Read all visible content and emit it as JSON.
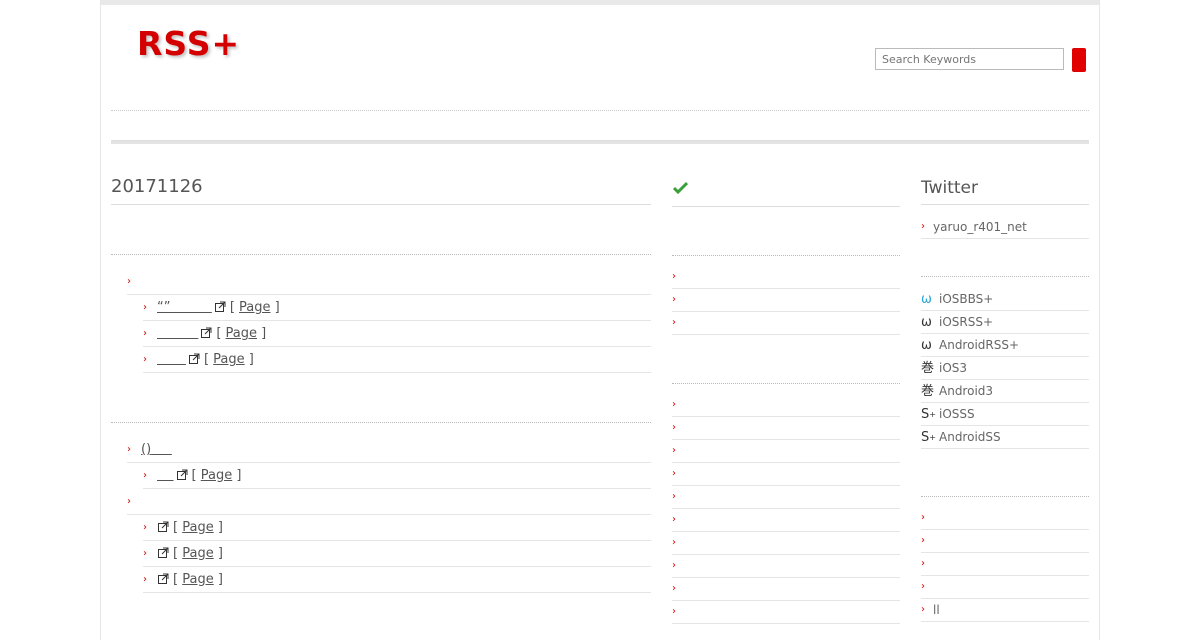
{
  "site": {
    "logo": "RSS+"
  },
  "search": {
    "placeholder": "Search Keywords",
    "value": "Search Keywords"
  },
  "main": {
    "date_heading": "20171126",
    "group1": {
      "items": [
        {
          "title": "“”",
          "page_label": "Page"
        },
        {
          "title": "",
          "page_label": "Page"
        },
        {
          "title": "",
          "page_label": "Page"
        }
      ]
    },
    "group2": {
      "header_title": "()",
      "items": [
        {
          "title": "",
          "page_label": "Page"
        }
      ]
    },
    "group3": {
      "items": [
        {
          "page_label": "Page"
        },
        {
          "page_label": "Page"
        },
        {
          "page_label": "Page"
        }
      ]
    },
    "bracket_open": "[",
    "bracket_close": "]"
  },
  "middle": {
    "check_icon": "checkmark-icon"
  },
  "right": {
    "twitter_heading": "Twitter",
    "twitter_user": "yaruo_r401_net",
    "apps": [
      {
        "glyph": "ω",
        "label": "iOSBBS+",
        "color": "#2aa6d8"
      },
      {
        "glyph": "ω",
        "label": "iOSRSS+",
        "color": "#333333"
      },
      {
        "glyph": "ω",
        "label": "AndroidRSS+",
        "color": "#333333"
      },
      {
        "glyph": "巻",
        "label": "iOS3",
        "color": "#333333"
      },
      {
        "glyph": "巻",
        "label": "Android3",
        "color": "#333333"
      },
      {
        "glyph": "S",
        "sup": "+",
        "label": "iOSSS",
        "color": "#333333"
      },
      {
        "glyph": "S",
        "sup": "+",
        "label": "AndroidSS",
        "color": "#333333"
      }
    ],
    "bottom_last": "ll"
  },
  "colors": {
    "accent": "#d40000",
    "button": "#e00000",
    "check": "#3aa03a"
  }
}
